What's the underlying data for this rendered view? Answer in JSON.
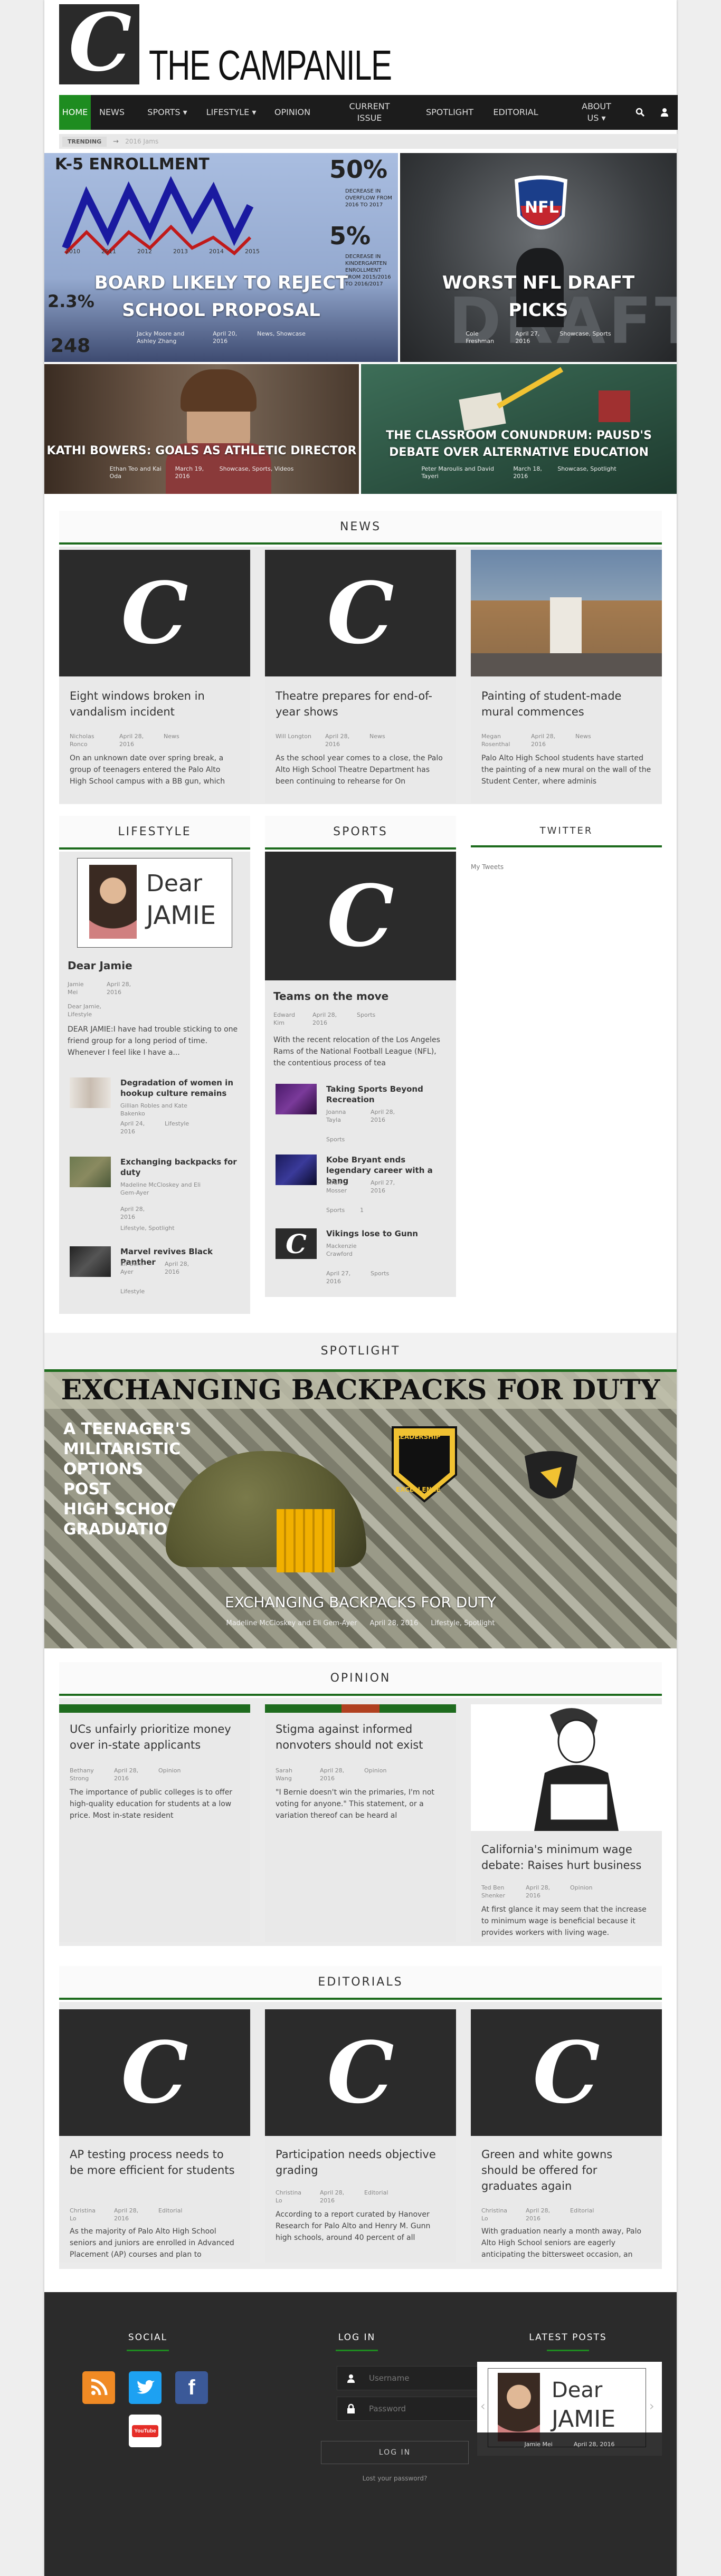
{
  "site": {
    "brand": "THE CAMPANILE",
    "logo_letter": "C"
  },
  "nav": [
    {
      "label": "HOME",
      "active": true
    },
    {
      "label": "NEWS"
    },
    {
      "label": "SPORTS ▾"
    },
    {
      "label": "LIFESTYLE ▾"
    },
    {
      "label": "OPINION"
    },
    {
      "label": "CURRENT ISSUE"
    },
    {
      "label": "SPOTLIGHT"
    },
    {
      "label": "EDITORIAL"
    },
    {
      "label": "ABOUT US ▾"
    }
  ],
  "trending": {
    "label": "TRENDING",
    "arrow": "→",
    "item": "2016 Jams"
  },
  "hero": [
    {
      "title": "BOARD LIKELY TO REJECT SCHOOL PROPOSAL",
      "author": "Jacky Moore and Ashley Zhang",
      "date": "April 20, 2016",
      "cats": "News, Showcase",
      "chart_text": "K-5 ENROLLMENT",
      "pct1": "50%",
      "pct2": "5%",
      "pct3": "2.3%",
      "num": "248",
      "side1": "DECREASE IN OVERFLOW FROM 2016 TO 2017",
      "side2": "DECREASE IN KINDERGARTEN ENROLLMENT FROM 2015/2016 TO 2016/2017",
      "years": [
        "2010",
        "2011",
        "2012",
        "2013",
        "2014",
        "2015"
      ]
    },
    {
      "title": "WORST NFL DRAFT PICKS",
      "author": "Cole Freshman",
      "date": "April 27, 2016",
      "cats": "Showcase, Sports",
      "shield": "NFL",
      "bg_text": "DRAFT"
    },
    {
      "title": "KATHI BOWERS: GOALS AS ATHLETIC DIRECTOR",
      "author": "Ethan Teo and Kai Oda",
      "date": "March 19, 2016",
      "cats": "Showcase, Sports, Videos"
    },
    {
      "title": "THE CLASSROOM CONUNDRUM: PAUSD'S DEBATE OVER ALTERNATIVE EDUCATION",
      "author": "Peter Maroulis and David Tayeri",
      "date": "March 18, 2016",
      "cats": "Showcase, Spotlight"
    }
  ],
  "news": {
    "heading": "NEWS",
    "cards": [
      {
        "title": "Eight windows broken in vandalism incident",
        "author": "Nicholas Ronco",
        "date": "April 28, 2016",
        "cat": "News",
        "excerpt": "On an unknown date over spring break, a group of teenagers entered the Palo Alto High School campus with a BB gun, which"
      },
      {
        "title": "Theatre prepares for end-of-year shows",
        "author": "Will Longton",
        "date": "April 28, 2016",
        "cat": "News",
        "excerpt": "As the school year comes to a close, the Palo Alto High School Theatre Department has been continuing to rehearse for On"
      },
      {
        "title": "Painting of student-made mural commences",
        "author": "Megan Rosenthal",
        "date": "April 28, 2016",
        "cat": "News",
        "excerpt": "Palo Alto High School students have started the painting of a new mural on the wall of the Student Center, where adminis"
      }
    ]
  },
  "lifestyle": {
    "heading": "LIFESTYLE",
    "feature": {
      "img_text1": "Dear",
      "img_text2": "JAMIE",
      "title": "Dear Jamie",
      "author": "Jamie Mei",
      "date": "April 28, 2016",
      "cat": "Dear Jamie, Lifestyle",
      "excerpt": "DEAR JAMIE:I have had trouble sticking to one friend group for a long period of time. Whenever I feel like I have a..."
    },
    "items": [
      {
        "title": "Degradation of women in hookup culture remains",
        "author": "Gillian Robles and Kate Bakenko",
        "date": "April 24, 2016",
        "cat": "Lifestyle"
      },
      {
        "title": "Exchanging backpacks for duty",
        "author": "Madeline McCloskey and Eli Gem-Ayer",
        "date": "April 28, 2016",
        "cat": "Lifestyle, Spotlight"
      },
      {
        "title": "Marvel revives Black Panther",
        "author": "Eli Gem-Ayer",
        "date": "April 28, 2016",
        "cat": "Lifestyle"
      }
    ]
  },
  "sports": {
    "heading": "SPORTS",
    "feature": {
      "title": "Teams on the move",
      "author": "Edward Kim",
      "date": "April 28, 2016",
      "cat": "Sports",
      "excerpt": "With the recent relocation of the Los Angeles Rams of the National Football League (NFL), the contentious process of tea"
    },
    "items": [
      {
        "title": "Taking Sports Beyond Recreation",
        "author": "Joanna Tayla",
        "date": "April 28, 2016",
        "cat": "Sports"
      },
      {
        "title": "Kobe Bryant ends legendary career with a bang",
        "author": "Eiran Mosser",
        "date": "April 27, 2016",
        "cat": "Sports",
        "count": "1"
      },
      {
        "title": "Vikings lose to Gunn",
        "author": "Mackenzie Crawford",
        "date": "April 27, 2016",
        "cat": "Sports"
      }
    ]
  },
  "twitter": {
    "heading": "TWITTER",
    "link": "My Tweets"
  },
  "spotlight": {
    "heading": "SPOTLIGHT",
    "banner": "EXCHANGING BACKPACKS FOR DUTY",
    "side_text": [
      "A TEENAGER'S",
      "MILITARISTIC",
      "OPTIONS",
      "POST",
      "HIGH SCHOOL",
      "GRADUATION"
    ],
    "badge_top": "LEADERSHIP",
    "badge_bottom": "EXCELLENCE",
    "title": "EXCHANGING BACKPACKS FOR DUTY",
    "author": "Madeline McCloskey and Eli Gem-Ayer",
    "date": "April 28, 2016",
    "cats": "Lifestyle, Spotlight"
  },
  "opinion": {
    "heading": "OPINION",
    "cards": [
      {
        "title": "UCs unfairly prioritize money over in-state applicants",
        "author": "Bethany Strong",
        "date": "April 28, 2016",
        "cat": "Opinion",
        "excerpt": "The importance of public colleges is to offer high-quality education for students at a low price. Most in-state resident"
      },
      {
        "title": "Stigma against informed nonvoters should not exist",
        "author": "Sarah Wang",
        "date": "April 28, 2016",
        "cat": "Opinion",
        "excerpt": "\"I Bernie doesn't win the primaries, I'm not voting for anyone.\" This statement, or a variation thereof can be heard al"
      },
      {
        "title": "California's minimum wage debate: Raises hurt business",
        "author": "Ted Ben Shenker",
        "date": "April 28, 2016",
        "cat": "Opinion",
        "excerpt": "At first glance it may seem that the increase to minimum wage is beneficial because it provides workers with living wage."
      }
    ]
  },
  "editorials": {
    "heading": "EDITORIALS",
    "cards": [
      {
        "title": "AP testing process needs to be more efficient for students",
        "author": "Christina Lo",
        "date": "April 28, 2016",
        "cat": "Editorial",
        "excerpt": "As the majority of Palo Alto High School seniors and juniors are enrolled in Advanced Placement (AP) courses and plan to"
      },
      {
        "title": "Participation needs objective grading",
        "author": "Christina Lo",
        "date": "April 28, 2016",
        "cat": "Editorial",
        "excerpt": "According to a report curated by Hanover Research for Palo Alto and Henry M. Gunn high schools, around 40 percent of all"
      },
      {
        "title": "Green and white gowns should be offered for graduates again",
        "author": "Christina Lo",
        "date": "April 28, 2016",
        "cat": "Editorial",
        "excerpt": "With graduation nearly a month away, Palo Alto High School seniors are eagerly anticipating the bittersweet occasion, an"
      }
    ]
  },
  "footer": {
    "social_heading": "SOCIAL",
    "login_heading": "LOG IN",
    "latest_heading": "LATEST POSTS",
    "username_placeholder": "Username",
    "password_placeholder": "Password",
    "login_button": "LOG IN",
    "lost_password": "Lost your password?",
    "youtube": "YouTube",
    "latest": {
      "title1": "Dear",
      "title2": "JAMIE",
      "author": "Jamie Mei",
      "date": "April 28, 2016"
    }
  },
  "colors": {
    "accent": "#1e8c20",
    "nav_bg": "#1c1c1c",
    "footer_bg": "#2b2b2b"
  }
}
